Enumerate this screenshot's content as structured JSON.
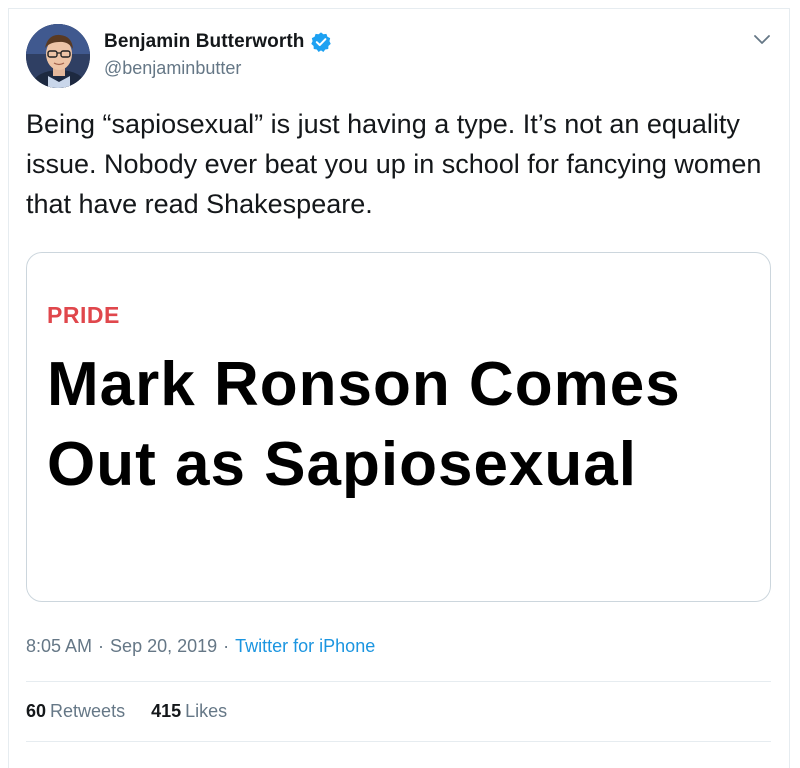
{
  "author": {
    "name": "Benjamin Butterworth",
    "handle": "@benjaminbutter",
    "verified": true
  },
  "tweet": {
    "text": "Being “sapiosexual” is just having a type. It’s not an equality issue. Nobody ever beat you up in school for fancying women that have read Shakespeare."
  },
  "card": {
    "category": "PRIDE",
    "headline": "Mark Ronson Comes Out as Sapiosexual"
  },
  "meta": {
    "time": "8:05 AM",
    "separator": "·",
    "date": "Sep 20, 2019",
    "source": "Twitter for iPhone"
  },
  "stats": {
    "retweets_count": "60",
    "retweets_label": "Retweets",
    "likes_count": "415",
    "likes_label": "Likes"
  },
  "icons": {
    "verified": "verified-badge-icon",
    "menu": "chevron-down-icon"
  },
  "colors": {
    "link": "#1b95e0",
    "verified": "#1da1f2",
    "category": "#e0474c",
    "secondary_text": "#657786"
  }
}
